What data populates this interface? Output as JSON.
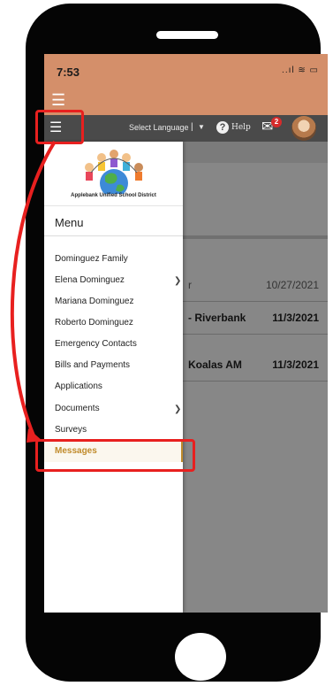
{
  "status": {
    "time": "7:53",
    "icons": "..ıl ≋ ▭"
  },
  "toolbar": {
    "language_label": "Select Language",
    "separator": "|",
    "language_caret": "▼",
    "help_label": "Help",
    "message_count": "2"
  },
  "drawer": {
    "logo_caption": "Applebank Unified School District",
    "menu_title": "Menu",
    "items": [
      {
        "label": "Dominguez Family",
        "has_chevron": false
      },
      {
        "label": "Elena Dominguez",
        "has_chevron": true
      },
      {
        "label": "Mariana Dominguez",
        "has_chevron": false
      },
      {
        "label": "Roberto Dominguez",
        "has_chevron": false
      },
      {
        "label": "Emergency Contacts",
        "has_chevron": false
      },
      {
        "label": "Bills and Payments",
        "has_chevron": false
      },
      {
        "label": "Applications",
        "has_chevron": false
      },
      {
        "label": "Documents",
        "has_chevron": true
      },
      {
        "label": "Surveys",
        "has_chevron": false
      },
      {
        "label": "Messages",
        "has_chevron": false,
        "active": true
      }
    ]
  },
  "background_rows": [
    {
      "text": "r",
      "date": "10/27/2021"
    },
    {
      "text": "- Riverbank",
      "date": "11/3/2021"
    },
    {
      "text": "Koalas AM",
      "date": "11/3/2021"
    }
  ],
  "colors": {
    "status_bar": "#d48f6a",
    "toolbar": "#4a4a4a",
    "highlight": "#e8201f",
    "active_item": "#c08a2a",
    "badge": "#d62b2b"
  },
  "icons": {
    "hamburger": "menu-icon",
    "help": "help-circle-icon",
    "mail": "envelope-icon",
    "chevron": "chevron-right-icon"
  }
}
